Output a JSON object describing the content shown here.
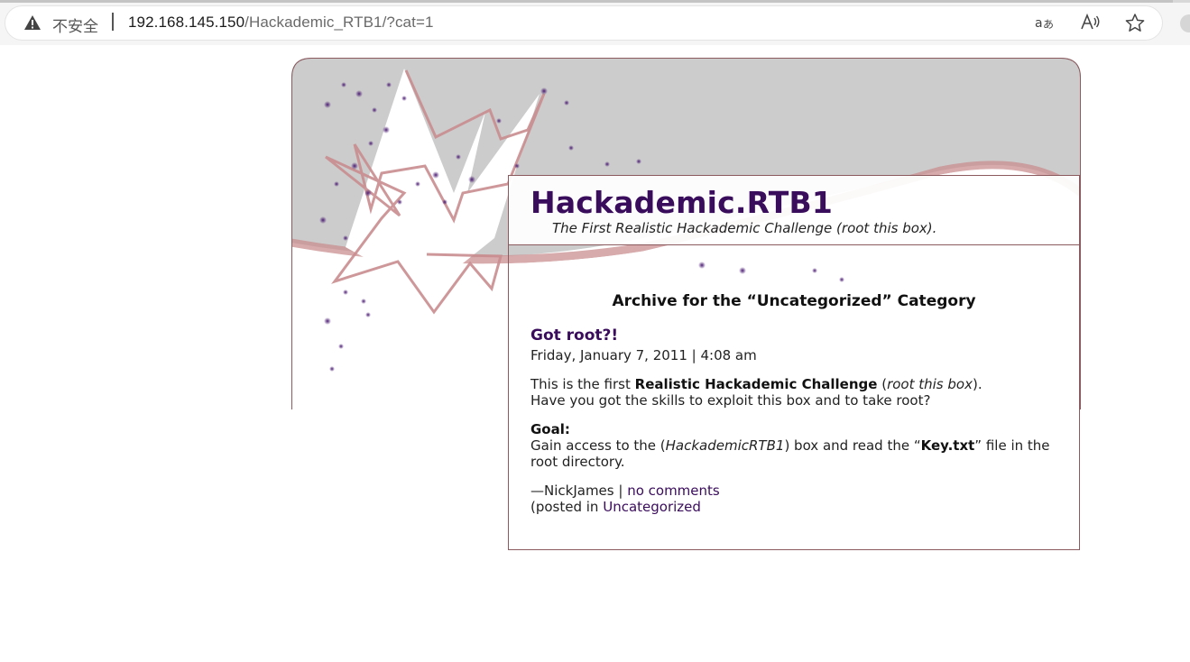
{
  "browser": {
    "security_label": "不安全",
    "url_host": "192.168.145.150",
    "url_path": "/Hackademic_RTB1/?cat=1",
    "icons": [
      "warning-icon",
      "read-aloud-translate-icon",
      "read-aloud-icon",
      "favorite-star-icon"
    ]
  },
  "site": {
    "title": "Hackademic.RTB1",
    "description": "The First Realistic Hackademic Challenge (root this box)."
  },
  "archive": {
    "heading": "Archive for the “Uncategorized” Category"
  },
  "post": {
    "title": "Got root?!",
    "date": "Friday, January 7, 2011 | 4:08 am",
    "p1_a": "This is the first ",
    "p1_b": "Realistic Hackademic Challenge",
    "p1_c": " (",
    "p1_d": "root this box",
    "p1_e": ").",
    "p1_line2": "Have you got the skills to exploit this box and to take root?",
    "goal_label": "Goal:",
    "goal_a": "Gain access to the (",
    "goal_b": "HackademicRTB1",
    "goal_c": ") box and read the “",
    "goal_d": "Key.txt",
    "goal_e": "” file in the root directory.",
    "author": "—NickJames | ",
    "comments_link": "no comments",
    "posted_in": "(posted in ",
    "category_link": "Uncategorized"
  },
  "colors": {
    "title_purple": "#3a0c5c",
    "border_mauve": "#8a5a5f",
    "star_stroke": "#c98d8f",
    "header_gray": "#cccccc"
  }
}
